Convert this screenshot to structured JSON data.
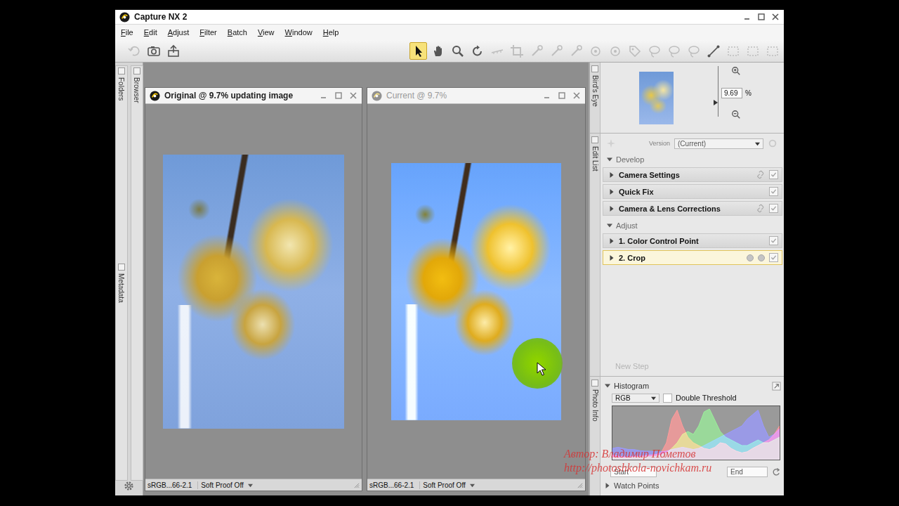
{
  "window": {
    "title": "Capture NX 2"
  },
  "menu": [
    {
      "label": "File"
    },
    {
      "label": "Edit"
    },
    {
      "label": "Adjust"
    },
    {
      "label": "Filter"
    },
    {
      "label": "Batch"
    },
    {
      "label": "View"
    },
    {
      "label": "Window"
    },
    {
      "label": "Help"
    }
  ],
  "toolbar": {
    "groups": [
      [
        {
          "kind": "undo",
          "selected": false,
          "disabled": true
        },
        {
          "kind": "browse",
          "selected": false,
          "disabled": false
        },
        {
          "kind": "export",
          "selected": false,
          "disabled": false
        }
      ],
      [
        {
          "kind": "pointer",
          "selected": true,
          "disabled": false
        },
        {
          "kind": "hand",
          "selected": false,
          "disabled": false
        },
        {
          "kind": "zoom",
          "selected": false,
          "disabled": false
        },
        {
          "kind": "rotate",
          "selected": false,
          "disabled": false
        },
        {
          "kind": "straighten",
          "selected": false,
          "disabled": true
        },
        {
          "kind": "crop",
          "selected": false,
          "disabled": true
        },
        {
          "kind": "brush",
          "selected": false,
          "disabled": true
        },
        {
          "kind": "brush",
          "selected": false,
          "disabled": true
        },
        {
          "kind": "brush",
          "selected": false,
          "disabled": true
        },
        {
          "kind": "point",
          "selected": false,
          "disabled": true
        },
        {
          "kind": "point",
          "selected": false,
          "disabled": true
        },
        {
          "kind": "tag",
          "selected": false,
          "disabled": true
        },
        {
          "kind": "lasso",
          "selected": false,
          "disabled": true
        },
        {
          "kind": "lasso",
          "selected": false,
          "disabled": true
        },
        {
          "kind": "lasso",
          "selected": false,
          "disabled": true
        },
        {
          "kind": "line",
          "selected": false,
          "disabled": false
        },
        {
          "kind": "select",
          "selected": false,
          "disabled": true
        },
        {
          "kind": "select",
          "selected": false,
          "disabled": true
        },
        {
          "kind": "select",
          "selected": false,
          "disabled": true
        }
      ]
    ]
  },
  "left_dock": {
    "columns": [
      {
        "tabs": [
          "Folders",
          "Metadata"
        ]
      },
      {
        "tabs": [
          "Browser"
        ]
      }
    ]
  },
  "image_windows": [
    {
      "title": "Original @ 9.7% updating image",
      "active": true,
      "profile": "sRGB...66-2.1",
      "soft_proof": "Soft Proof Off",
      "control_point": false
    },
    {
      "title": "Current @ 9.7%",
      "active": false,
      "profile": "sRGB...66-2.1",
      "soft_proof": "Soft Proof Off",
      "control_point": true
    }
  ],
  "birds_eye": {
    "tab": "Bird's Eye",
    "zoom": "9.69",
    "unit": "%",
    "level": 0.22
  },
  "edit_list": {
    "tab": "Edit List",
    "version_label": "Version",
    "version": "(Current)",
    "sections": [
      {
        "title": "Develop",
        "expanded": true,
        "steps": [
          {
            "label": "Camera Settings",
            "expanded": false,
            "checked": true,
            "selected": false,
            "linked": true,
            "mask_controls": false
          },
          {
            "label": "Quick Fix",
            "expanded": false,
            "checked": true,
            "selected": false,
            "linked": false,
            "mask_controls": false
          },
          {
            "label": "Camera & Lens Corrections",
            "expanded": false,
            "checked": true,
            "selected": false,
            "linked": true,
            "mask_controls": false
          }
        ]
      },
      {
        "title": "Adjust",
        "expanded": true,
        "steps": [
          {
            "label": "1. Color Control Point",
            "expanded": false,
            "checked": true,
            "selected": false,
            "linked": false,
            "mask_controls": false
          },
          {
            "label": "2. Crop",
            "expanded": false,
            "checked": true,
            "selected": true,
            "linked": false,
            "mask_controls": true
          }
        ]
      }
    ],
    "new_step": {
      "label": "New Step",
      "disabled": true
    }
  },
  "photo_info": {
    "tab": "Photo Info"
  },
  "histogram": {
    "title": "Histogram",
    "expanded": true,
    "channel": "RGB",
    "double_threshold": {
      "label": "Double Threshold",
      "checked": false
    },
    "chart": {
      "series": [
        {
          "name": "Red",
          "color": "#ff0000",
          "values": [
            8,
            6,
            5,
            5,
            6,
            6,
            7,
            8,
            9,
            12,
            30,
            72,
            88,
            60,
            40,
            30,
            25,
            20,
            18,
            22,
            30,
            28,
            20,
            15,
            12,
            14,
            20,
            25,
            30,
            35,
            45,
            60
          ]
        },
        {
          "name": "Green",
          "color": "#00d400",
          "values": [
            4,
            3,
            3,
            3,
            4,
            4,
            5,
            5,
            6,
            8,
            12,
            20,
            30,
            45,
            50,
            45,
            60,
            85,
            90,
            70,
            50,
            40,
            35,
            30,
            25,
            25,
            30,
            35,
            30,
            30,
            35,
            40
          ]
        },
        {
          "name": "Blue",
          "color": "#0000ff",
          "values": [
            20,
            22,
            20,
            18,
            18,
            16,
            15,
            15,
            14,
            14,
            15,
            18,
            20,
            22,
            20,
            18,
            20,
            25,
            30,
            35,
            40,
            45,
            50,
            55,
            60,
            72,
            80,
            88,
            60,
            40,
            45,
            55
          ]
        }
      ]
    },
    "start": "Start",
    "end": "End"
  },
  "watch_points": {
    "title": "Watch Points",
    "expanded": false
  },
  "watermark": {
    "lines": [
      "Автор: Владимир Пометов",
      "http://photoshkola-novichkam.ru"
    ]
  }
}
